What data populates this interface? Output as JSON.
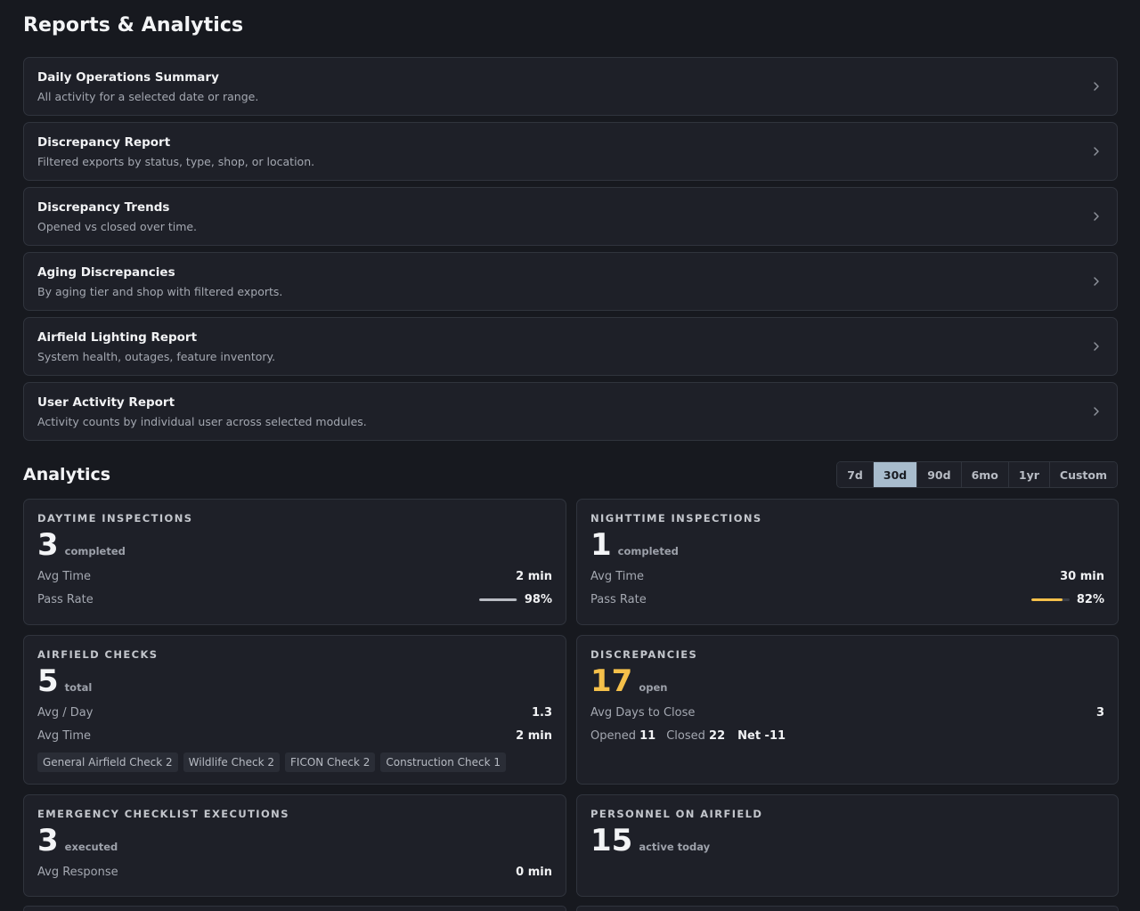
{
  "page": {
    "title": "Reports & Analytics"
  },
  "reports": [
    {
      "title": "Daily Operations Summary",
      "description": "All activity for a selected date or range."
    },
    {
      "title": "Discrepancy Report",
      "description": "Filtered exports by status, type, shop, or location."
    },
    {
      "title": "Discrepancy Trends",
      "description": "Opened vs closed over time."
    },
    {
      "title": "Aging Discrepancies",
      "description": "By aging tier and shop with filtered exports."
    },
    {
      "title": "Airfield Lighting Report",
      "description": "System health, outages, feature inventory."
    },
    {
      "title": "User Activity Report",
      "description": "Activity counts by individual user across selected modules."
    }
  ],
  "analytics": {
    "title": "Analytics",
    "ranges": [
      "7d",
      "30d",
      "90d",
      "6mo",
      "1yr",
      "Custom"
    ],
    "selected_range": "30d"
  },
  "cards": {
    "daytime": {
      "label": "DAYTIME INSPECTIONS",
      "value": "3",
      "unit": "completed",
      "avg_time_label": "Avg Time",
      "avg_time": "2 min",
      "pass_rate_label": "Pass Rate",
      "pass_rate": "98%",
      "pass_rate_fraction": 0.98,
      "bar_color": "#b9bcc3"
    },
    "nighttime": {
      "label": "NIGHTTIME INSPECTIONS",
      "value": "1",
      "unit": "completed",
      "avg_time_label": "Avg Time",
      "avg_time": "30 min",
      "pass_rate_label": "Pass Rate",
      "pass_rate": "82%",
      "pass_rate_fraction": 0.82,
      "bar_color": "#f5c04a"
    },
    "airfield_checks": {
      "label": "AIRFIELD CHECKS",
      "value": "5",
      "unit": "total",
      "avg_day_label": "Avg / Day",
      "avg_day": "1.3",
      "avg_time_label": "Avg Time",
      "avg_time": "2 min",
      "tags": [
        "General Airfield Check 2",
        "Wildlife Check 2",
        "FICON Check 2",
        "Construction Check 1"
      ]
    },
    "discrepancies": {
      "label": "DISCREPANCIES",
      "value": "17",
      "unit": "open",
      "value_color": "#f5c04a",
      "avg_days_label": "Avg Days to Close",
      "avg_days": "3",
      "opened_label": "Opened",
      "opened": "11",
      "closed_label": "Closed",
      "closed": "22",
      "net": "Net -11"
    },
    "emergency": {
      "label": "EMERGENCY CHECKLIST EXECUTIONS",
      "value": "3",
      "unit": "executed",
      "avg_response_label": "Avg Response",
      "avg_response": "0 min"
    },
    "personnel": {
      "label": "PERSONNEL ON AIRFIELD",
      "value": "15",
      "unit": "active today"
    }
  }
}
